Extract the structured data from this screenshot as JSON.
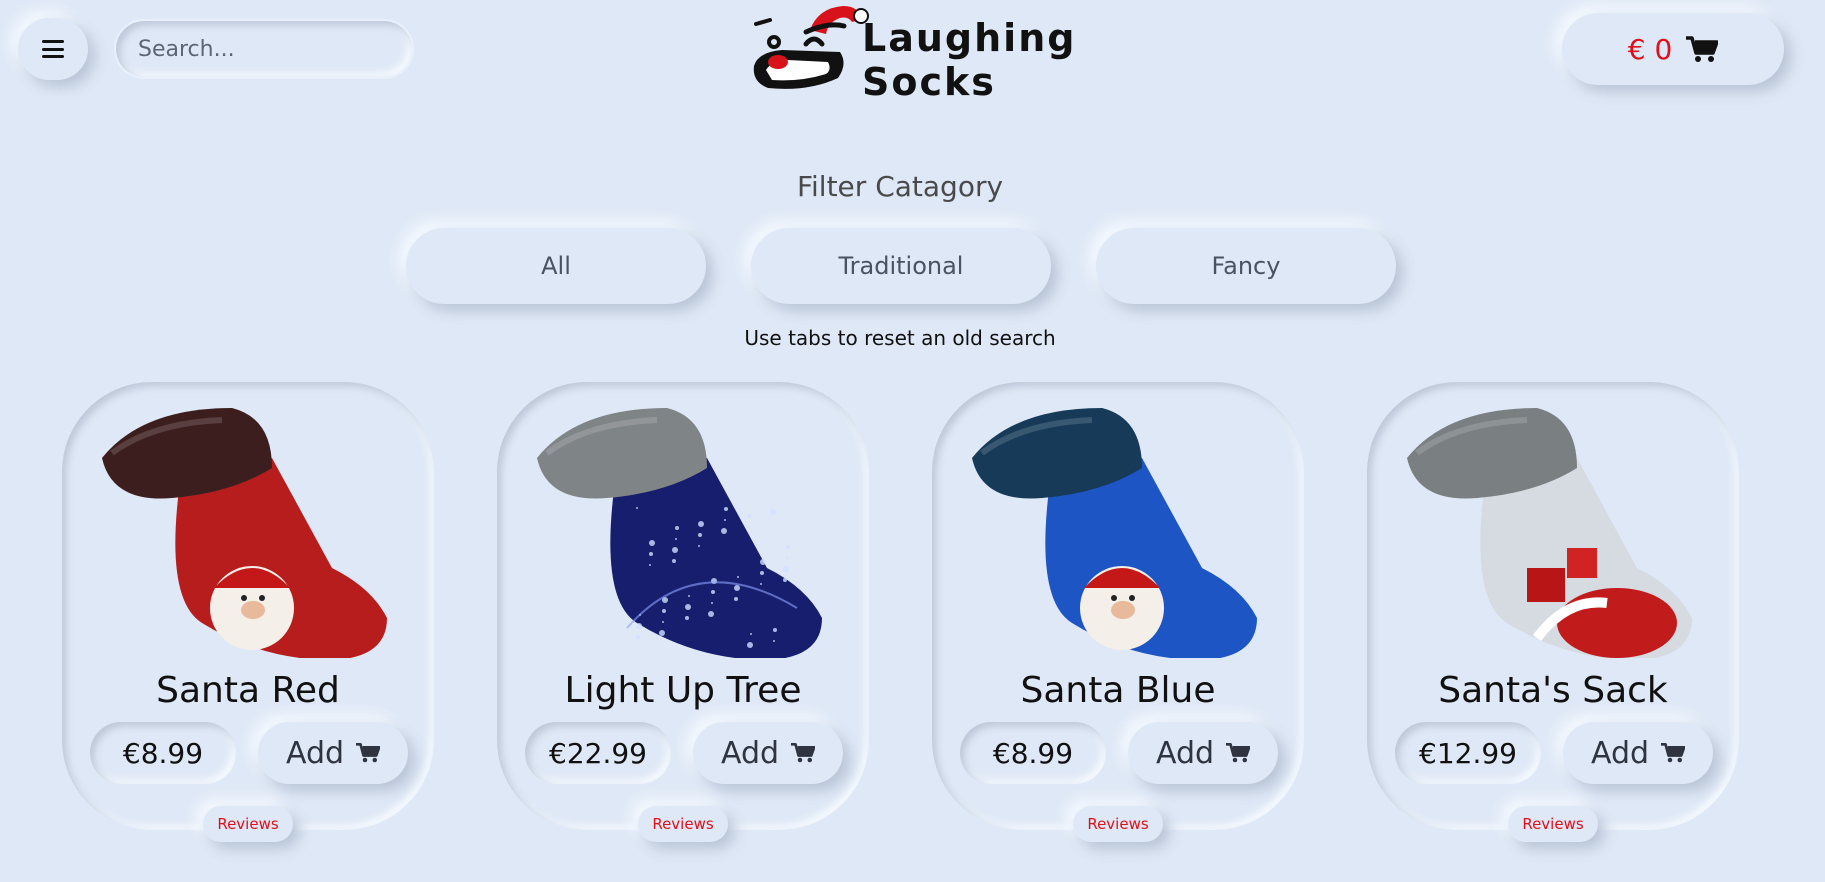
{
  "header": {
    "search_placeholder": "Search...",
    "logo_line1": "Laughing",
    "logo_line2": "Socks",
    "cart_total": "€ 0"
  },
  "filter": {
    "title": "Filter Catagory",
    "tabs": [
      {
        "label": "All"
      },
      {
        "label": "Traditional"
      },
      {
        "label": "Fancy"
      }
    ],
    "hint": "Use tabs to reset an old search"
  },
  "products": [
    {
      "name": "Santa Red",
      "price": "€8.99",
      "add_label": "Add",
      "reviews_label": "Reviews",
      "cuff": "#3d1e1e",
      "body": "#b81d1d",
      "decoration": "santa"
    },
    {
      "name": "Light Up Tree",
      "price": "€22.99",
      "add_label": "Add",
      "reviews_label": "Reviews",
      "cuff": "#7f8487",
      "body": "#171e6e",
      "decoration": "sparkles"
    },
    {
      "name": "Santa Blue",
      "price": "€8.99",
      "add_label": "Add",
      "reviews_label": "Reviews",
      "cuff": "#163a58",
      "body": "#1d55c4",
      "decoration": "santa"
    },
    {
      "name": "Santa's Sack",
      "price": "€12.99",
      "add_label": "Add",
      "reviews_label": "Reviews",
      "cuff": "#7a7f82",
      "body": "#d6dbe2",
      "decoration": "sack"
    }
  ],
  "colors": {
    "background": "#dfe8f6",
    "accent_red": "#e0101a"
  }
}
